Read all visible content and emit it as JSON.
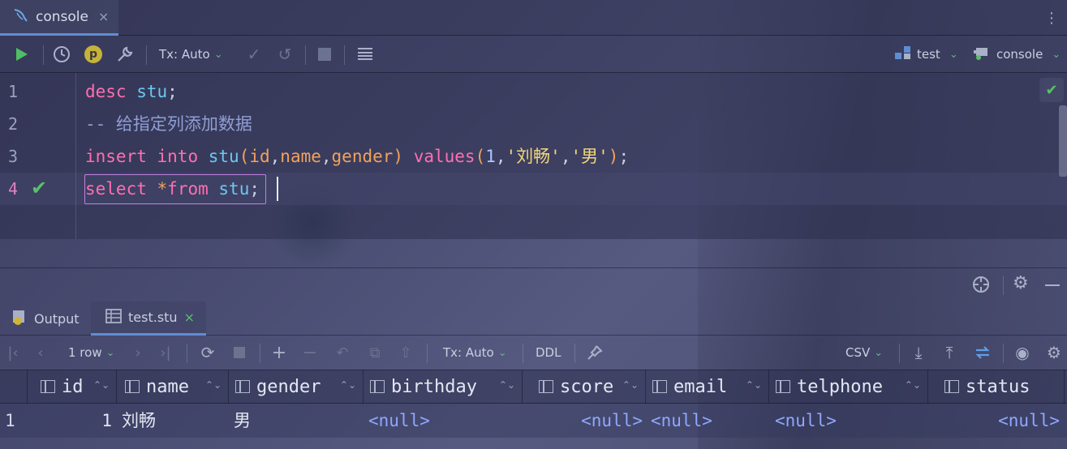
{
  "tab": {
    "label": "console",
    "close": "×"
  },
  "toolbar": {
    "tx_label": "Tx: Auto",
    "datasource": "test",
    "session": "console",
    "p_badge": "p"
  },
  "editor": {
    "lines": [
      {
        "num": "1"
      },
      {
        "num": "2"
      },
      {
        "num": "3"
      },
      {
        "num": "4"
      }
    ],
    "line1": {
      "kw": "desc",
      "table": "stu",
      "end": ";"
    },
    "line2": {
      "comment": "-- 给指定列添加数据"
    },
    "line3": {
      "kw1": "insert",
      "kw2": "into",
      "table": "stu",
      "p1": "(",
      "c1": "id",
      "comma1": ",",
      "c2": "name",
      "comma2": ",",
      "c3": "gender",
      "p2": ")",
      "kw3": "values",
      "p3": "(",
      "n1": "1",
      "comma3": ",",
      "s1": "'刘畅'",
      "comma4": ",",
      "s2": "'男'",
      "p4": ")",
      "end": ";"
    },
    "line4": {
      "kw1": "select",
      "star": "*",
      "kw2": "from",
      "table": "stu",
      "end": ";"
    }
  },
  "bottom_tabs": {
    "output": "Output",
    "result": "test.stu",
    "close": "×"
  },
  "results_toolbar": {
    "rows": "1 row",
    "tx_label": "Tx: Auto",
    "ddl": "DDL",
    "export": "CSV"
  },
  "grid": {
    "columns": [
      "id",
      "name",
      "gender",
      "birthday",
      "score",
      "email",
      "telphone",
      "status"
    ],
    "rows": [
      {
        "num": "1",
        "id": "1",
        "name": "刘畅",
        "gender": "男",
        "birthday": "<null>",
        "score": "<null>",
        "email": "<null>",
        "telphone": "<null>",
        "status": "<null>"
      }
    ]
  },
  "colors": {
    "keyword": "#ff6fb0",
    "table": "#6cc8f0",
    "column": "#f2a25a",
    "string": "#f2d77a",
    "null": "#8fa7ff",
    "accent": "#5f8dd3",
    "ok": "#57c266"
  }
}
